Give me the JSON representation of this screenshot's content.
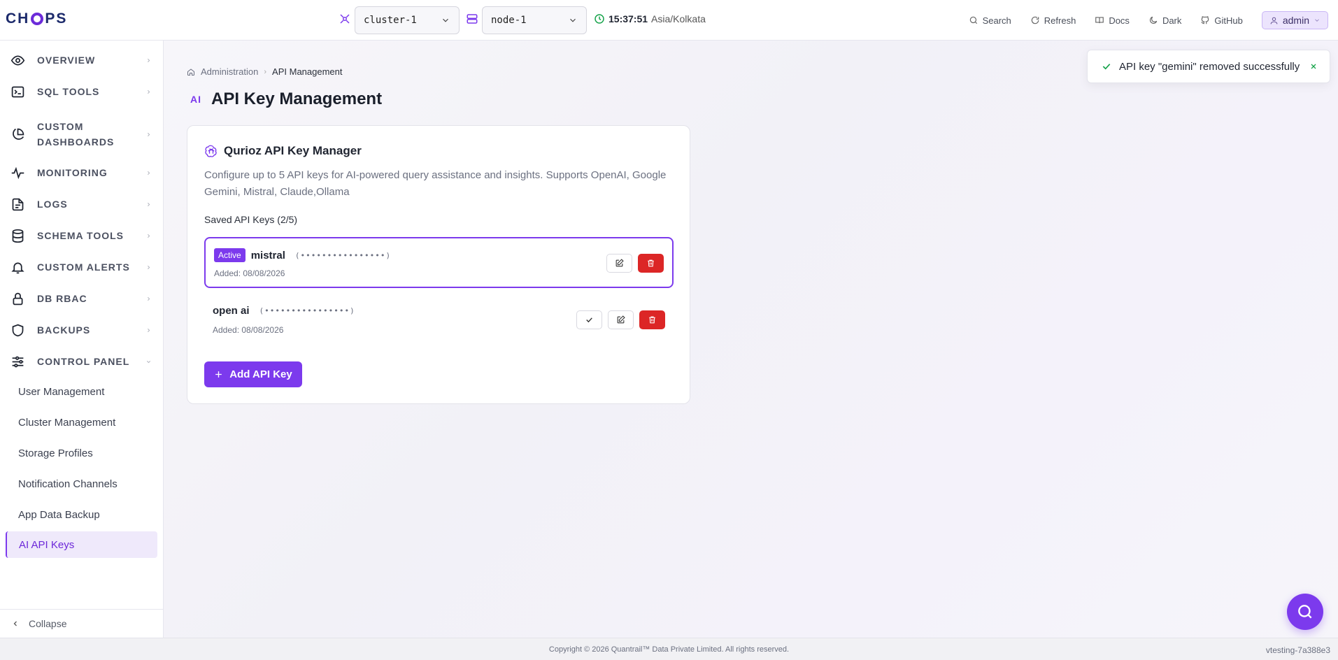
{
  "brand": {
    "logo_text_left": "CH",
    "logo_text_right": "PS"
  },
  "header": {
    "cluster_select": "cluster-1",
    "node_select": "node-1",
    "time": "15:37:51",
    "timezone": "Asia/Kolkata",
    "actions": {
      "search": "Search",
      "refresh": "Refresh",
      "docs": "Docs",
      "dark": "Dark",
      "github": "GitHub"
    },
    "user": "admin"
  },
  "sidebar": {
    "items": [
      {
        "label": "OVERVIEW",
        "icon": "eye-icon"
      },
      {
        "label": "SQL TOOLS",
        "icon": "terminal-icon"
      },
      {
        "label": "CUSTOM DASHBOARDS",
        "icon": "pie-chart-icon"
      },
      {
        "label": "MONITORING",
        "icon": "activity-icon"
      },
      {
        "label": "LOGS",
        "icon": "file-icon"
      },
      {
        "label": "SCHEMA TOOLS",
        "icon": "database-icon"
      },
      {
        "label": "CUSTOM ALERTS",
        "icon": "bell-icon"
      },
      {
        "label": "DB RBAC",
        "icon": "lock-icon"
      },
      {
        "label": "BACKUPS",
        "icon": "shield-icon"
      },
      {
        "label": "CONTROL PANEL",
        "icon": "sliders-icon"
      }
    ],
    "sub_items": [
      {
        "label": "User Management"
      },
      {
        "label": "Cluster Management"
      },
      {
        "label": "Storage Profiles"
      },
      {
        "label": "Notification Channels"
      },
      {
        "label": "App Data Backup"
      },
      {
        "label": "AI API Keys"
      }
    ],
    "collapse_label": "Collapse"
  },
  "breadcrumb": {
    "parent": "Administration",
    "current": "API Management"
  },
  "page": {
    "badge": "AI",
    "title": "API Key Management"
  },
  "card": {
    "title": "Qurioz API Key Manager",
    "description": "Configure up to 5 API keys for AI-powered query assistance and insights. Supports OpenAI, Google Gemini, Mistral, Claude,Ollama",
    "saved_title": "Saved API Keys (2/5)",
    "keys": [
      {
        "name": "mistral",
        "masked": "(••••••••••••••••)",
        "added": "Added: 08/08/2026",
        "active_label": "Active"
      },
      {
        "name": "open ai",
        "masked": "(••••••••••••••••)",
        "added": "Added: 08/08/2026"
      }
    ],
    "add_label": "Add API Key"
  },
  "toast": {
    "message": "API key \"gemini\" removed successfully"
  },
  "footer": {
    "copyright": "Copyright © 2026 Quantrail™ Data Private Limited. All rights reserved.",
    "version": "vtesting-7a388e3"
  },
  "colors": {
    "accent": "#7c3aed",
    "danger": "#dc2626",
    "success": "#16a34a"
  }
}
